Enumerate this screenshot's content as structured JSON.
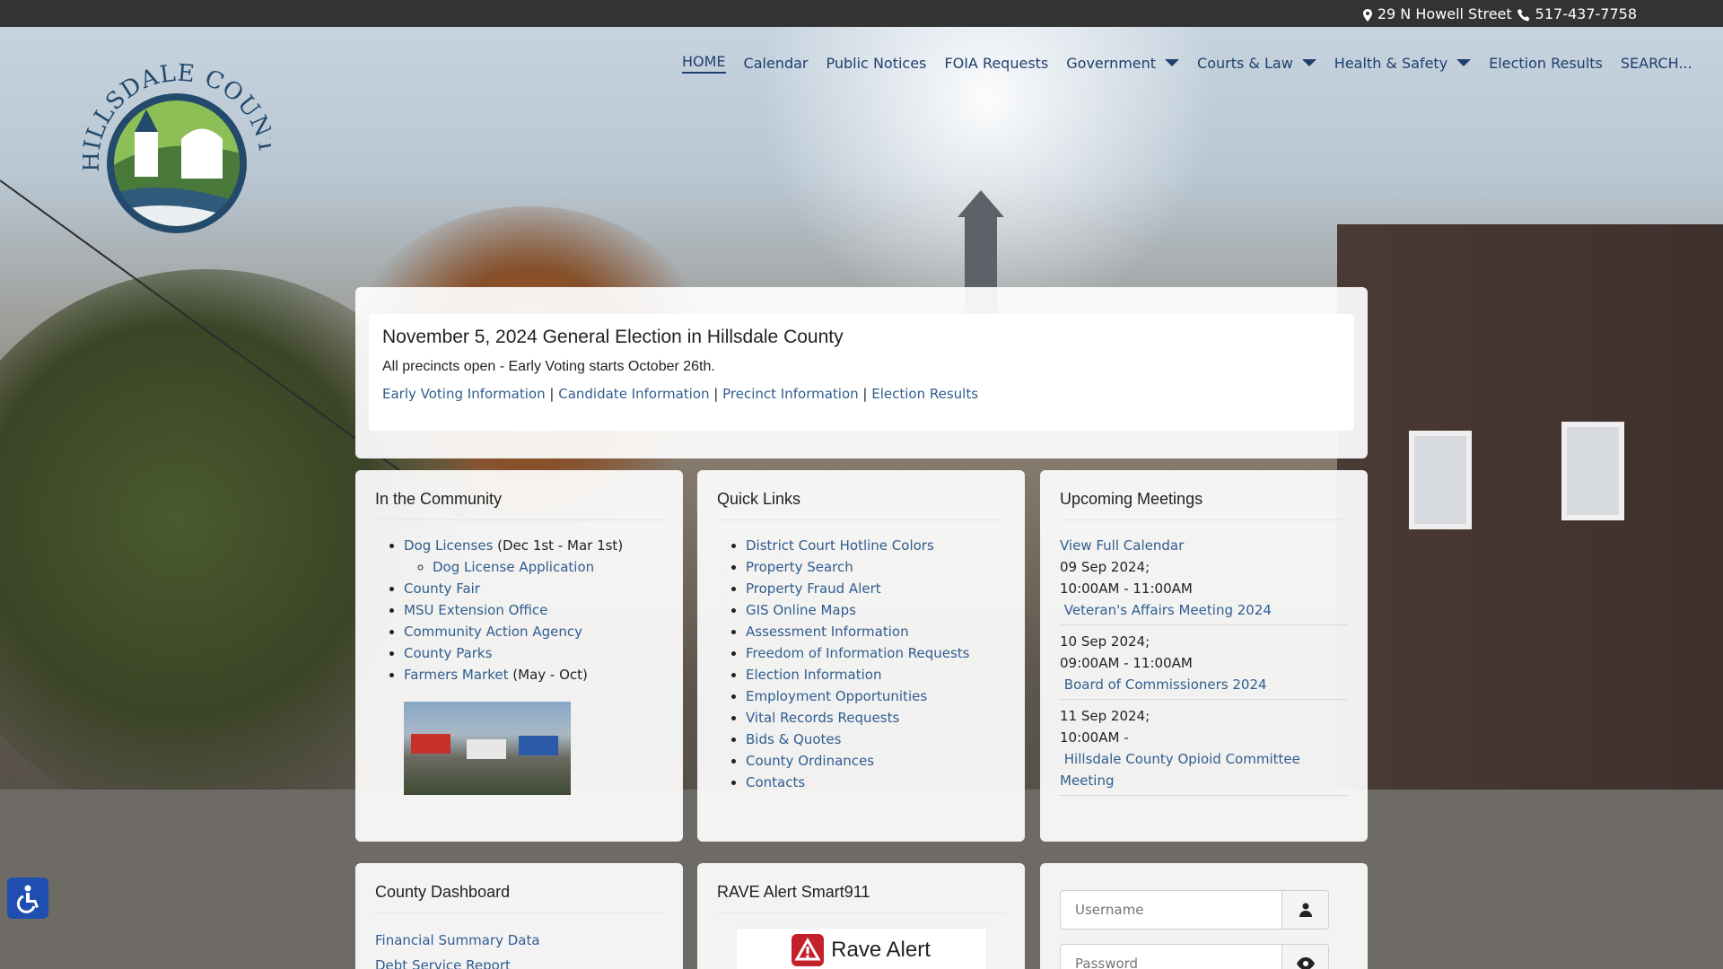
{
  "topbar": {
    "address": "29 N Howell Street",
    "phone": "517-437-7758"
  },
  "logo": {
    "text": "HILLSDALE COUNTY"
  },
  "nav": {
    "items": [
      {
        "label": "HOME"
      },
      {
        "label": "Calendar"
      },
      {
        "label": "Public Notices"
      },
      {
        "label": "FOIA Requests"
      },
      {
        "label": "Government"
      },
      {
        "label": "Courts & Law"
      },
      {
        "label": "Health & Safety"
      },
      {
        "label": "Election Results"
      },
      {
        "label": "SEARCH..."
      }
    ]
  },
  "alert": {
    "title": "November 5, 2024 General Election in Hillsdale County",
    "subtitle": "All precincts open - Early Voting starts October 26th.",
    "links": [
      "Early Voting Information",
      "Candidate Information",
      "Precinct Information",
      "Election Results"
    ],
    "separator": "|"
  },
  "community": {
    "title": "In the Community",
    "items": [
      {
        "link": "Dog Licenses",
        "note": "(Dec 1st - Mar 1st)"
      },
      {
        "sub": "Dog License Application"
      },
      {
        "link": "County Fair"
      },
      {
        "link": "MSU Extension Office"
      },
      {
        "link": "Community Action Agency"
      },
      {
        "link": "County Parks"
      },
      {
        "link": "Farmers Market",
        "note": "(May - Oct)"
      }
    ]
  },
  "quick_links": {
    "title": "Quick Links",
    "items": [
      "District Court Hotline Colors",
      "Property Search",
      "Property Fraud Alert",
      "GIS Online Maps",
      "Assessment Information",
      "Freedom of Information Requests",
      "Election Information",
      "Employment Opportunities",
      "Vital Records Requests",
      "Bids & Quotes",
      "County Ordinances",
      "Contacts"
    ]
  },
  "meetings": {
    "title": "Upcoming Meetings",
    "view_all": "View Full Calendar",
    "items": [
      {
        "date": "09 Sep 2024;",
        "time": "10:00AM - 11:00AM",
        "name": "Veteran's Affairs Meeting 2024"
      },
      {
        "date": "10 Sep 2024;",
        "time": "09:00AM - 11:00AM",
        "name": "Board of Commissioners 2024"
      },
      {
        "date": "11 Sep 2024;",
        "time": "10:00AM -",
        "name": "Hillsdale County Opioid Committee Meeting"
      }
    ]
  },
  "dashboard": {
    "title": "County Dashboard",
    "items": [
      "Financial Summary Data",
      "Debt Service Report"
    ]
  },
  "rave": {
    "title": "RAVE Alert Smart911",
    "logo_text": "Rave Alert"
  },
  "login": {
    "username_placeholder": "Username",
    "password_placeholder": "Password"
  },
  "colors": {
    "link": "#2f5d8f",
    "nav": "#1f3f6e",
    "topbar": "#333333"
  }
}
